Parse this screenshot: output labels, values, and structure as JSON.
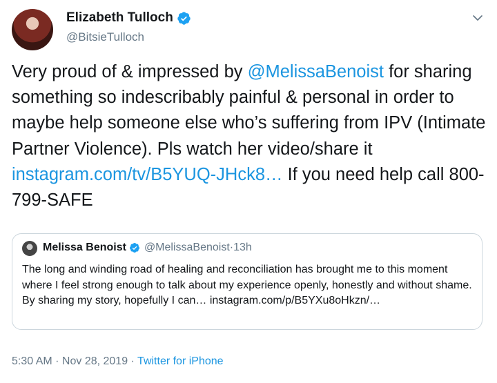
{
  "author": {
    "display_name": "Elizabeth Tulloch",
    "handle": "@BitsieTulloch"
  },
  "tweet": {
    "text_1": "Very proud of & impressed by ",
    "mention": "@MelissaBenoist",
    "text_2": " for sharing something so indescribably painful & personal in order to maybe help someone else who’s suffering from IPV (Intimate Partner Violence). Pls watch her video/share it ",
    "link": "instagram.com/tv/B5YUQ-JHck8…",
    "text_3": " If you need help call 800-799-SAFE"
  },
  "quoted": {
    "display_name": "Melissa Benoist",
    "handle": "@MelissaBenoist",
    "separator": " · ",
    "time": "13h",
    "text": "The long and winding road of healing and reconciliation has brought me to this moment where I feel strong enough to talk about my experience openly, honestly and without shame. By sharing my story, hopefully I can… instagram.com/p/B5YXu8oHkzn/…"
  },
  "footer": {
    "time": "5:30 AM",
    "separator": " · ",
    "date": "Nov 28, 2019",
    "source": "Twitter for iPhone"
  },
  "colors": {
    "link": "#1b95e0",
    "muted": "#657786",
    "verified": "#1da1f2"
  },
  "icons": [
    "verified-badge-icon",
    "chevron-down-icon"
  ]
}
